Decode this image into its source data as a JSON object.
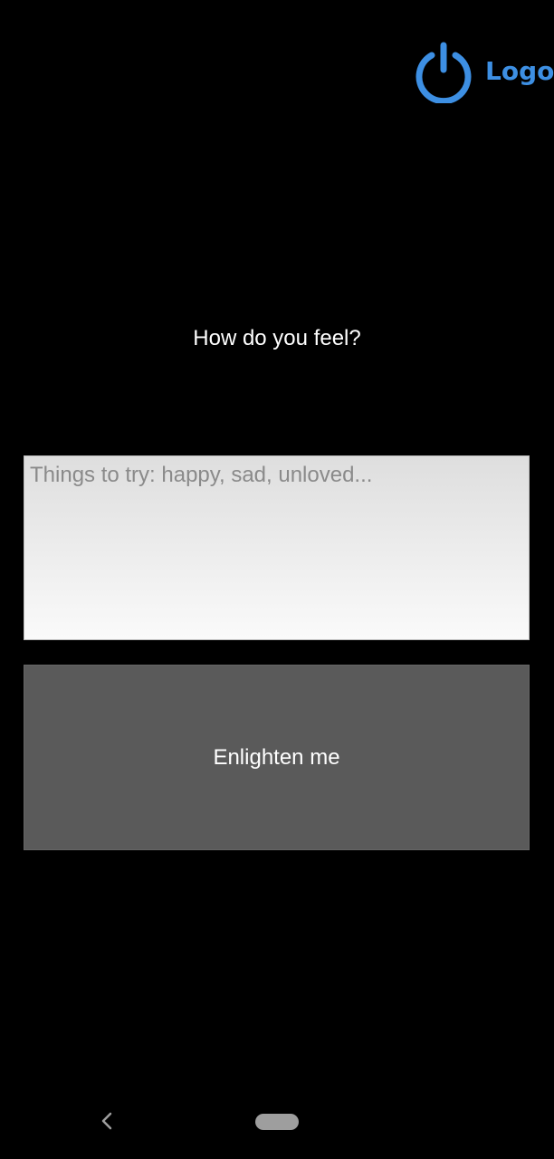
{
  "header": {
    "logout_label": "Logout",
    "logout_icon": "power-icon",
    "accent_color": "#3d8fe3"
  },
  "main": {
    "prompt": "How do you feel?",
    "feeling_input": {
      "placeholder": "Things to try: happy, sad, unloved...",
      "value": ""
    },
    "submit_label": "Enlighten me"
  },
  "nav": {
    "back_icon": "back-chevron-icon",
    "home_icon": "home-pill-icon"
  }
}
